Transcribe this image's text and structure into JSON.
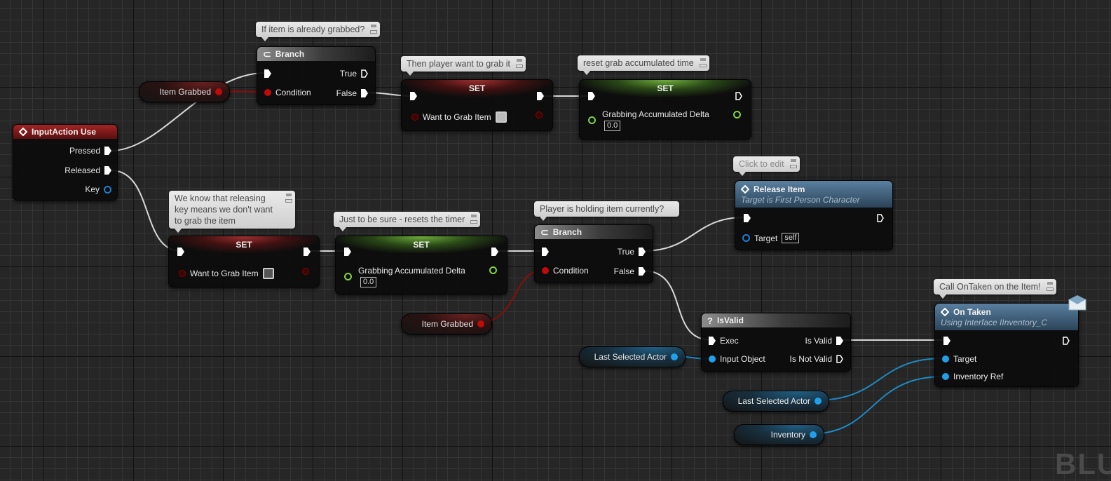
{
  "app": "Unreal Engine Blueprint Editor - Event Graph",
  "colors": {
    "exec": "#ffffff",
    "bool": "#c20a0a",
    "float": "#84d23c",
    "object": "#1fa0e8",
    "event_header": "#a32424",
    "function_header": "#5a7fa0"
  },
  "comments": {
    "c1": "If item is already grabbed?",
    "c2": "Then player want to grab it",
    "c3": "reset grab accumulated time",
    "c4": "We know that releasing key means we don't want to grab the item",
    "c5": "Just to be sure - resets the timer",
    "c6": "Player is holding item currently?",
    "c7": "Click to edit",
    "c8": "Call OnTaken on the Item!"
  },
  "nodes": {
    "input_action": {
      "icon": "event-diamond-icon",
      "title": "InputAction Use",
      "pins": {
        "pressed": "Pressed",
        "released": "Released",
        "key": "Key"
      }
    },
    "branch1": {
      "icon": "branch-icon",
      "title": "Branch",
      "pins": {
        "condition": "Condition",
        "true": "True",
        "false": "False"
      }
    },
    "branch2": {
      "icon": "branch-icon",
      "title": "Branch",
      "pins": {
        "condition": "Condition",
        "true": "True",
        "false": "False"
      }
    },
    "set_grab_true": {
      "title": "SET",
      "var": "Want to Grab Item",
      "value": true
    },
    "set_grab_false": {
      "title": "SET",
      "var": "Want to Grab Item",
      "value": false
    },
    "set_delta1": {
      "title": "SET",
      "var": "Grabbing Accumulated Delta",
      "value": "0.0"
    },
    "set_delta2": {
      "title": "SET",
      "var": "Grabbing Accumulated Delta",
      "value": "0.0"
    },
    "release_item": {
      "icon": "function-diamond-icon",
      "title": "Release Item",
      "subtitle": "Target is First Person Character",
      "pins": {
        "target": "Target",
        "target_value": "self"
      }
    },
    "is_valid": {
      "icon": "question-icon",
      "title": "IsValid",
      "pins": {
        "exec": "Exec",
        "input_object": "Input Object",
        "is_valid": "Is Valid",
        "is_not_valid": "Is Not Valid"
      }
    },
    "on_taken": {
      "icon": "function-diamond-icon",
      "title": "On Taken",
      "subtitle": "Using Interface IInventory_C",
      "badge": "message-envelope-icon",
      "pins": {
        "target": "Target",
        "inventory_ref": "Inventory Ref"
      }
    }
  },
  "variables": {
    "item_grabbed_1": "Item Grabbed",
    "item_grabbed_2": "Item Grabbed",
    "last_selected_actor_1": "Last Selected Actor",
    "last_selected_actor_2": "Last Selected Actor",
    "inventory": "Inventory"
  },
  "watermark": "BLU"
}
